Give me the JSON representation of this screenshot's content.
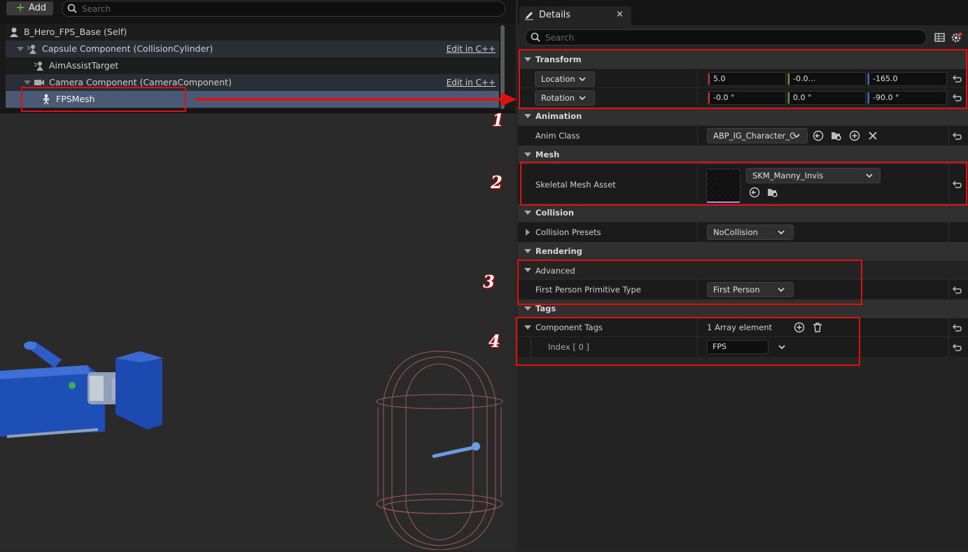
{
  "left": {
    "add_label": "Add",
    "search_placeholder": "Search",
    "tree": [
      {
        "label": "B_Hero_FPS_Base (Self)",
        "edit": ""
      },
      {
        "label": "Capsule Component (CollisionCylinder)",
        "edit": "Edit in C++"
      },
      {
        "label": "AimAssistTarget",
        "edit": ""
      },
      {
        "label": "Camera Component (CameraComponent)",
        "edit": "Edit in C++"
      },
      {
        "label": "FPSMesh",
        "edit": ""
      }
    ]
  },
  "details": {
    "tab_label": "Details",
    "tab_close": "×",
    "search_placeholder": "Search",
    "categories": {
      "transform": "Transform",
      "animation": "Animation",
      "mesh": "Mesh",
      "collision": "Collision",
      "rendering": "Rendering",
      "tags": "Tags"
    },
    "location": {
      "label": "Location",
      "x": "5.0",
      "y": "-0.0...",
      "z": "-165.0"
    },
    "rotation": {
      "label": "Rotation",
      "x": "-0.0 °",
      "y": "0.0 °",
      "z": "-90.0 °"
    },
    "anim_class": {
      "label": "Anim Class",
      "value": "ABP_IG_Character_C"
    },
    "skeletal_mesh": {
      "label": "Skeletal Mesh Asset",
      "value": "SKM_Manny_Invis"
    },
    "collision_presets": {
      "label": "Collision Presets",
      "value": "NoCollision"
    },
    "advanced": {
      "label": "Advanced"
    },
    "fp_primitive": {
      "label": "First Person Primitive Type",
      "value": "First Person"
    },
    "component_tags": {
      "label": "Component Tags",
      "value": "1 Array element"
    },
    "index0": {
      "label": "Index [ 0 ]",
      "value": "FPS"
    }
  },
  "annotations": [
    "1",
    "2",
    "3",
    "4"
  ],
  "colors": {
    "annotation_red": "#e01010",
    "selection": "#4a5a74",
    "x_axis": "#c83232",
    "y_axis": "#5fa02e",
    "z_axis": "#3a6ecf"
  },
  "icons": [
    "plus-icon",
    "search-icon",
    "pawn-icon",
    "component-icon",
    "camera-icon",
    "skeleton-icon",
    "pencil-icon",
    "table-icon",
    "gear-icon",
    "reset-icon",
    "browse-icon",
    "folder-search-icon",
    "add-circle-icon",
    "clear-icon",
    "trash-icon",
    "chevron-down-icon"
  ]
}
